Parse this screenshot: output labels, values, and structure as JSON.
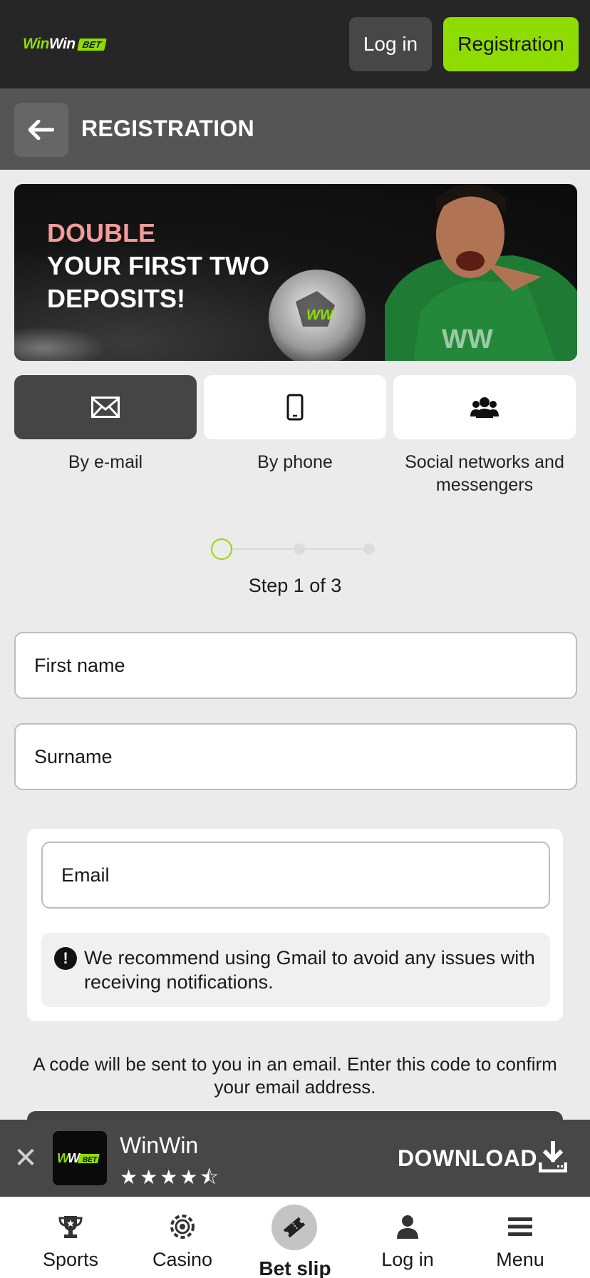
{
  "header": {
    "logo": {
      "part1": "Win",
      "part2": "Win",
      "badge": "BET"
    },
    "login_label": "Log in",
    "registration_label": "Registration"
  },
  "subheader": {
    "title": "REGISTRATION"
  },
  "promo": {
    "highlight": "DOUBLE",
    "line2": "YOUR FIRST TWO",
    "line3": "DEPOSITS!",
    "highlight_color": "#f49a9a"
  },
  "methods": [
    {
      "label": "By e-mail",
      "icon": "envelope-icon",
      "active": true
    },
    {
      "label": "By phone",
      "icon": "phone-icon",
      "active": false
    },
    {
      "label": "Social networks and messengers",
      "icon": "users-icon",
      "active": false
    }
  ],
  "stepper": {
    "current": 1,
    "total": 3,
    "text": "Step 1 of 3"
  },
  "form": {
    "first_name_placeholder": "First name",
    "surname_placeholder": "Surname",
    "email_placeholder": "Email",
    "hint": "We recommend using Gmail to avoid any issues with receiving notifications.",
    "code_note": "A code will be sent to you in an email. Enter this code to confirm your email address."
  },
  "app_banner": {
    "name": "WinWin",
    "rating": 4.5,
    "stars_display": "★★★★⯪",
    "download_label": "DOWNLOAD"
  },
  "bottom_nav": [
    {
      "label": "Sports",
      "icon": "trophy-icon"
    },
    {
      "label": "Casino",
      "icon": "casino-chip-icon"
    },
    {
      "label": "Bet slip",
      "icon": "ticket-icon"
    },
    {
      "label": "Log in",
      "icon": "user-icon"
    },
    {
      "label": "Menu",
      "icon": "menu-icon"
    }
  ],
  "colors": {
    "accent": "#8fdc00",
    "header_bg": "#262626",
    "subheader_bg": "#555555",
    "page_bg": "#ebebeb"
  }
}
